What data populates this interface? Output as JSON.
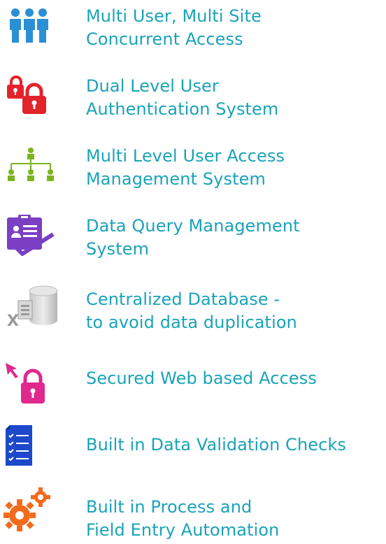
{
  "colors": {
    "text": "#1aa3b9",
    "users": "#2b8fd6",
    "locks": "#e3222b",
    "hierarchy": "#7ab51d",
    "query": "#7b3fc4",
    "database": "#9a9a9a",
    "secure": "#e0288f",
    "validation": "#1c49c9",
    "automation": "#f26b1d"
  },
  "features": [
    {
      "icon": "users-group-icon",
      "lines": [
        "Multi User, Multi Site",
        "Concurrent Access"
      ]
    },
    {
      "icon": "padlocks-icon",
      "lines": [
        "Dual Level User",
        "Authentication System"
      ]
    },
    {
      "icon": "org-hierarchy-icon",
      "lines": [
        "Multi Level User Access",
        "Management System"
      ]
    },
    {
      "icon": "clipboard-query-icon",
      "lines": [
        "Data Query Management",
        "System"
      ]
    },
    {
      "icon": "database-excel-icon",
      "lines": [
        "Centralized Database -",
        "to avoid data duplication"
      ]
    },
    {
      "icon": "cursor-lock-icon",
      "lines": [
        "Secured Web based Access"
      ]
    },
    {
      "icon": "checklist-icon",
      "lines": [
        "Built in Data Validation Checks"
      ]
    },
    {
      "icon": "gears-icon",
      "lines": [
        "Built in Process and",
        "Field Entry Automation"
      ]
    }
  ]
}
